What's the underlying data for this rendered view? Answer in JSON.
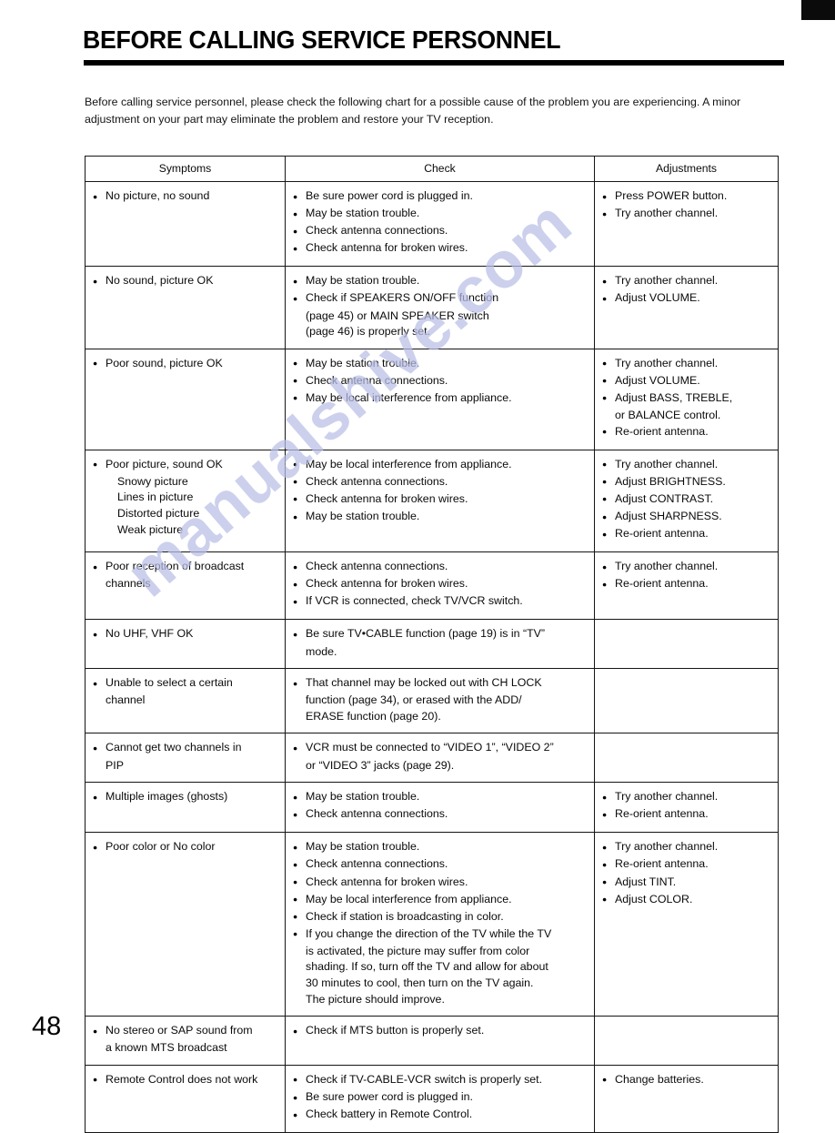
{
  "page": {
    "title": "BEFORE CALLING SERVICE PERSONNEL",
    "intro": "Before calling service personnel, please check the following chart for a possible cause of the problem you are experiencing.  A minor adjustment on your part may eliminate the problem and restore your TV reception.",
    "page_number": "48",
    "watermark": "manualshive.com",
    "watermark_color": "#b9bfe6"
  },
  "table": {
    "headers": [
      "Symptoms",
      "Check",
      "Adjustments"
    ],
    "rows": [
      {
        "symptoms": [
          "No picture, no sound"
        ],
        "symptom_subs": [],
        "check": [
          "Be sure power cord is plugged in.",
          "May be station trouble.",
          "Check antenna connections.",
          "Check antenna for broken wires."
        ],
        "check_wraps": [],
        "adjustments": [
          "Press POWER button.",
          "Try another channel."
        ]
      },
      {
        "symptoms": [
          "No sound, picture OK"
        ],
        "symptom_subs": [],
        "check": [
          "May be station trouble.",
          "Check if SPEAKERS ON/OFF function"
        ],
        "check_wraps": [
          "(page 45) or MAIN SPEAKER switch",
          "(page 46) is properly set."
        ],
        "adjustments": [
          "Try another channel.",
          "Adjust VOLUME."
        ]
      },
      {
        "symptoms": [
          "Poor sound, picture OK"
        ],
        "symptom_subs": [],
        "check": [
          "May be station trouble.",
          "Check antenna connections.",
          "May be local interference from appliance."
        ],
        "check_wraps": [],
        "adjustments": [
          "Try another channel.",
          "Adjust VOLUME.",
          "Adjust BASS, TREBLE,"
        ],
        "adjustment_wraps": [
          "or BALANCE control."
        ],
        "adjustments_tail": [
          "Re-orient antenna."
        ]
      },
      {
        "symptoms": [
          "Poor picture, sound OK"
        ],
        "symptom_subs": [
          "Snowy picture",
          "Lines in picture",
          "Distorted picture",
          "Weak picture"
        ],
        "check": [
          "May be local interference from appliance.",
          "Check antenna connections.",
          "Check antenna for broken wires.",
          "May be station trouble."
        ],
        "check_wraps": [],
        "adjustments": [
          "Try another channel.",
          "Adjust BRIGHTNESS.",
          "Adjust CONTRAST.",
          "Adjust SHARPNESS.",
          "Re-orient antenna."
        ]
      },
      {
        "symptoms": [
          "Poor reception of broadcast"
        ],
        "symptom_wraps": [
          "channels"
        ],
        "symptom_subs": [],
        "check": [
          "Check antenna connections.",
          "Check antenna for broken wires.",
          "If VCR is connected, check TV/VCR switch."
        ],
        "check_wraps": [],
        "adjustments": [
          "Try another channel.",
          "Re-orient antenna."
        ]
      },
      {
        "symptoms": [
          "No UHF, VHF OK"
        ],
        "symptom_subs": [],
        "check": [
          "Be sure TV•CABLE function (page 19) is in “TV”"
        ],
        "check_wraps": [
          "mode."
        ],
        "adjustments": []
      },
      {
        "symptoms": [
          "Unable to select a certain"
        ],
        "symptom_wraps": [
          "channel"
        ],
        "symptom_subs": [],
        "check": [
          "That channel may be locked out with CH LOCK"
        ],
        "check_wraps": [
          "function (page 34), or erased with the ADD/",
          "ERASE function (page 20)."
        ],
        "adjustments": []
      },
      {
        "symptoms": [
          "Cannot get two channels in"
        ],
        "symptom_wraps": [
          "PIP"
        ],
        "symptom_subs": [],
        "check": [
          "VCR must be connected to “VIDEO 1”, “VIDEO 2”"
        ],
        "check_wraps": [
          "or “VIDEO 3” jacks (page 29)."
        ],
        "adjustments": []
      },
      {
        "symptoms": [
          "Multiple images (ghosts)"
        ],
        "symptom_subs": [],
        "check": [
          "May be station trouble.",
          "Check antenna connections."
        ],
        "check_wraps": [],
        "adjustments": [
          "Try another channel.",
          "Re-orient antenna."
        ]
      },
      {
        "symptoms": [
          "Poor color or No color"
        ],
        "symptom_subs": [],
        "check": [
          "May be station trouble.",
          "Check antenna connections.",
          "Check antenna for broken wires.",
          "May be local interference from appliance.",
          "Check if station is broadcasting in color.",
          "If you change the direction of the TV while the TV"
        ],
        "check_wraps": [
          "is activated, the picture may suffer from color",
          "shading. If so, turn off the TV and allow for about",
          "30 minutes to cool, then turn on the TV again.",
          "The picture should improve."
        ],
        "adjustments": [
          "Try another channel.",
          "Re-orient antenna.",
          "Adjust TINT.",
          "Adjust COLOR."
        ]
      },
      {
        "symptoms": [
          "No stereo or SAP sound from"
        ],
        "symptom_wraps": [
          "a known MTS broadcast"
        ],
        "symptom_subs": [],
        "check": [
          "Check if MTS button is properly set."
        ],
        "check_wraps": [],
        "adjustments": []
      },
      {
        "symptoms": [
          "Remote Control does not work"
        ],
        "symptom_subs": [],
        "check": [
          "Check if TV-CABLE-VCR switch is properly set.",
          "Be sure power cord is plugged in.",
          "Check battery in Remote Control."
        ],
        "check_wraps": [],
        "adjustments": [
          "Change batteries."
        ]
      }
    ]
  }
}
